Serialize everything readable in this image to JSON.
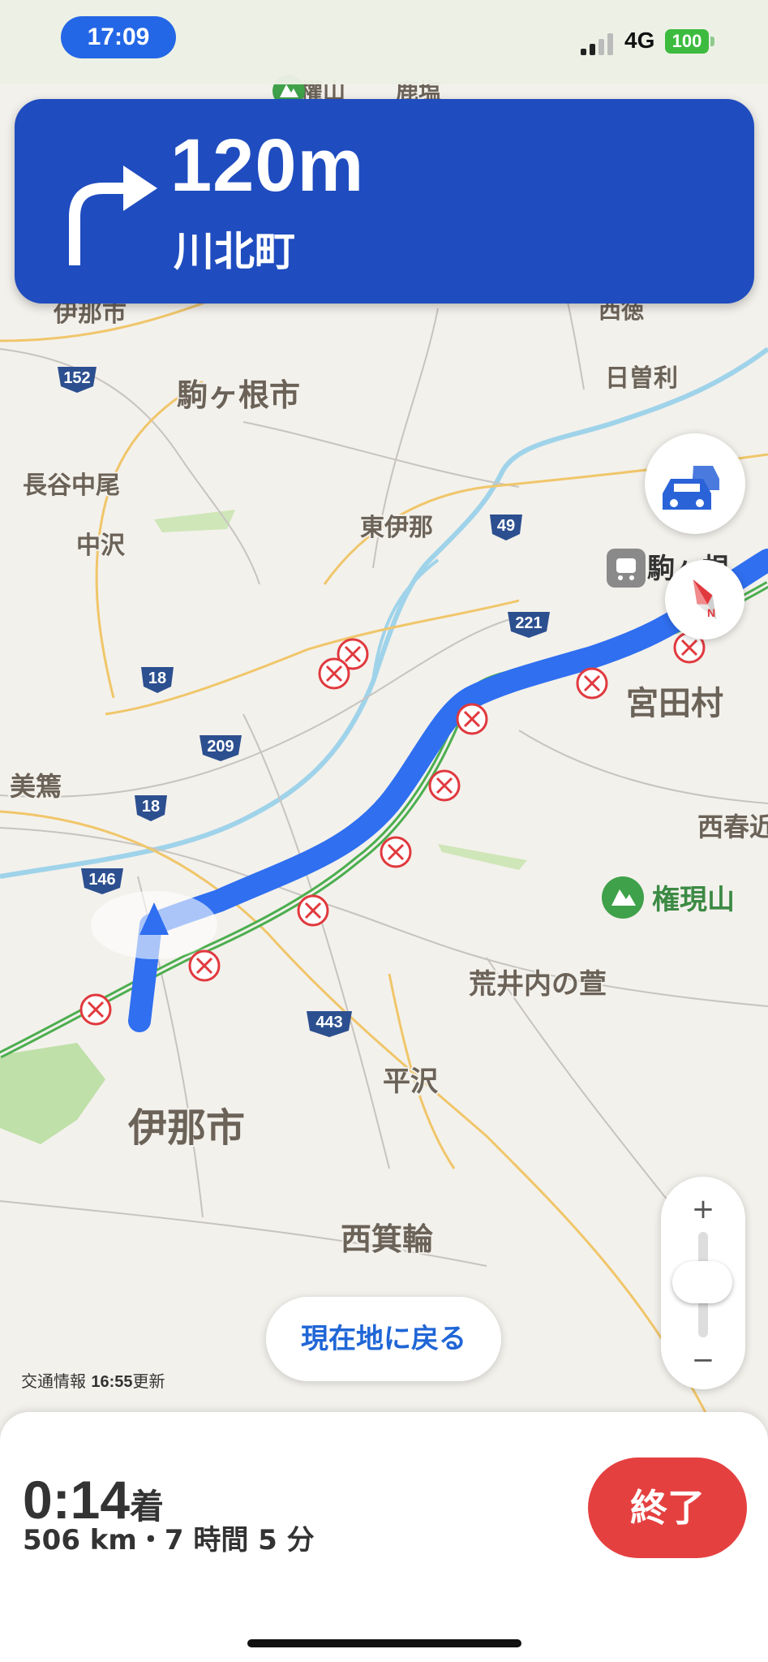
{
  "status_bar": {
    "time": "17:09",
    "network": "4G",
    "battery": "100"
  },
  "navigation": {
    "distance": "120m",
    "street": "川北町",
    "maneuver_icon": "turn-right-icon"
  },
  "map": {
    "place_labels": {
      "inashi_top": "伊那市",
      "nishitoku": "西徳",
      "komagane": "駒ヶ根市",
      "hisoli": "日曽利",
      "hasenakao": "長谷中尾",
      "nakazawa": "中沢",
      "higashiina": "東伊那",
      "komagane_station": "駒ヶ根",
      "miyadamura": "宮田村",
      "misuzu": "美篶",
      "nishiharu": "西春近",
      "gongenyama": "権現山",
      "arainouchi": "荒井内の萱",
      "hirasawa": "平沢",
      "inashi": "伊那市",
      "nishiminowa": "西箕輪",
      "top_clip1": "權山",
      "top_clip2": "鹿塩"
    },
    "route_shields": [
      "152",
      "49",
      "221",
      "18",
      "209",
      "18",
      "146",
      "443"
    ],
    "colors": {
      "route": "#2f6ff0",
      "highway": "#4cae4f",
      "closure": "#e0393e",
      "banner": "#1f4cbf"
    }
  },
  "controls": {
    "traffic_button_icon": "traffic-cars-icon",
    "compass_label": "N",
    "zoom_in": "+",
    "zoom_out": "−",
    "recenter_label": "現在地に戻る",
    "traffic_info_prefix": "交通情報 ",
    "traffic_info_time": "16:55",
    "traffic_info_suffix": "更新"
  },
  "trip": {
    "eta_time": "0:14",
    "eta_suffix": "着",
    "summary": "506 km・7 時間 5 分",
    "end_label": "終了"
  }
}
